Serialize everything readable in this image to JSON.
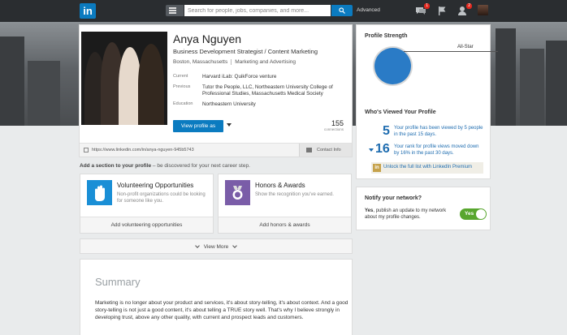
{
  "nav": {
    "logo": "in",
    "search_placeholder": "Search for people, jobs, companies, and more...",
    "advanced": "Advanced",
    "messages_badge": "1",
    "notifications_badge": "2"
  },
  "profile": {
    "name": "Anya Nguyen",
    "headline": "Business Development Strategist / Content Marketing",
    "location": "Boston, Massachusetts",
    "industry": "Marketing and Advertising",
    "current_label": "Current",
    "current_value": "Harvard iLab: QuikForce venture",
    "previous_label": "Previous",
    "previous_value": "Tutor the People, LLC, Northeastern University College of Professional Studies, Massachusetts Medical Society",
    "education_label": "Education",
    "education_value": "Northeastern University",
    "view_profile_label": "View profile as",
    "connections_count": "155",
    "connections_label": "connections",
    "url": "https://www.linkedin.com/in/anya-nguyen-945b5743",
    "contact_info": "Contact Info"
  },
  "add_section": {
    "title_bold": "Add a section to your profile",
    "title_rest": " – be discovered for your next career step.",
    "volunteering": {
      "title": "Volunteering Opportunities",
      "desc": "Non-profit organizations could be looking for someone like you.",
      "action": "Add volunteering opportunities"
    },
    "honors": {
      "title": "Honors & Awards",
      "desc": "Show the recognition you've earned.",
      "action": "Add honors & awards"
    },
    "view_more": "View More"
  },
  "summary": {
    "title": "Summary",
    "text": "Marketing is no longer about your product and services, it's about story-telling, it's about context. And a good story-telling is not just a good content, it's about telling a TRUE story well. That's why I believe strongly in developing trust, above any other quality, with current and prospect leads and customers."
  },
  "strength": {
    "title": "Profile Strength",
    "level": "All-Star"
  },
  "views": {
    "title": "Who's Viewed Your Profile",
    "views_num": "5",
    "views_text": "Your profile has been viewed by 5 people in the past 15 days.",
    "rank_num": "16",
    "rank_text": "Your rank for profile views moved down by 16% in the past 30 days.",
    "premium_text": "Unlock the full list with LinkedIn Premium"
  },
  "notify": {
    "title": "Notify your network?",
    "text_bold": "Yes",
    "text_rest": ", publish an update to my network about my profile changes.",
    "toggle_label": "Yes"
  },
  "colors": {
    "brand": "#0b7bc0",
    "nav_bg": "#2a2d30",
    "toggle_on": "#58a62e",
    "volunteer_icon": "#1a8fd6",
    "honors_icon": "#7a5da8"
  }
}
